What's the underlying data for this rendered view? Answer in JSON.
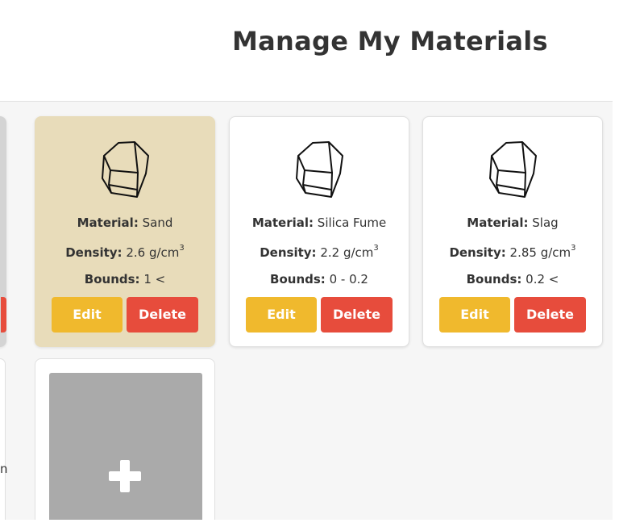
{
  "page": {
    "title": "Manage My Materials"
  },
  "labels": {
    "material": "Material:",
    "density": "Density:",
    "bounds": "Bounds:",
    "density_unit": "g/cm",
    "density_exp": "3"
  },
  "actions": {
    "edit": "Edit",
    "delete": "Delete"
  },
  "partial": {
    "text": "n"
  },
  "materials": [
    {
      "name": "Sand",
      "density": "2.6",
      "bounds": "1 <",
      "selected": true
    },
    {
      "name": "Silica Fume",
      "density": "2.2",
      "bounds": "0 - 0.2",
      "selected": false
    },
    {
      "name": "Slag",
      "density": "2.85",
      "bounds": "0.2 <",
      "selected": false
    }
  ],
  "add_card": {
    "icon": "plus-icon"
  },
  "colors": {
    "edit": "#f0b92d",
    "delete": "#e74c3c",
    "selected_card": "#e8dcba",
    "add_tile": "#aaaaaa"
  }
}
